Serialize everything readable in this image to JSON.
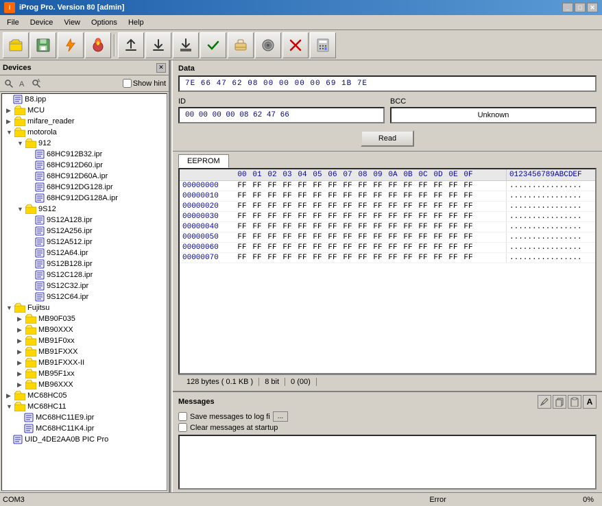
{
  "titleBar": {
    "title": "iProg Pro. Version 80 [admin]",
    "icon": "i"
  },
  "menuBar": {
    "items": [
      "File",
      "Device",
      "View",
      "Options",
      "Help"
    ]
  },
  "toolbar": {
    "buttons": [
      {
        "name": "open-button",
        "icon": "📂",
        "unicode": "📂"
      },
      {
        "name": "save-button",
        "icon": "💾",
        "unicode": "💾"
      },
      {
        "name": "flash-button",
        "icon": "⚡",
        "unicode": "⚡"
      },
      {
        "name": "burn-button",
        "icon": "🔴",
        "unicode": "🔴"
      },
      {
        "name": "upload-button",
        "icon": "▲",
        "unicode": "▲"
      },
      {
        "name": "download-button",
        "icon": "▼",
        "unicode": "▼"
      },
      {
        "name": "download2-button",
        "icon": "⬇",
        "unicode": "⬇"
      },
      {
        "name": "verify-button",
        "icon": "✔",
        "unicode": "✔"
      },
      {
        "name": "erase-button",
        "icon": "🧹",
        "unicode": "🧹"
      },
      {
        "name": "chip-button",
        "icon": "💿",
        "unicode": "💿"
      },
      {
        "name": "stop-button",
        "icon": "✖",
        "unicode": "✖"
      },
      {
        "name": "calc-button",
        "icon": "🖩",
        "unicode": "🖩"
      }
    ]
  },
  "devicesPanel": {
    "title": "Devices",
    "showHintLabel": "Show hint",
    "tree": [
      {
        "id": "b8ipp",
        "label": "B8.ipp",
        "level": 0,
        "type": "file",
        "expanded": false
      },
      {
        "id": "mcu",
        "label": "MCU",
        "level": 0,
        "type": "folder",
        "expanded": false
      },
      {
        "id": "mifare_reader",
        "label": "mifare_reader",
        "level": 0,
        "type": "folder",
        "expanded": false
      },
      {
        "id": "motorola",
        "label": "motorola",
        "level": 0,
        "type": "folder",
        "expanded": true
      },
      {
        "id": "912",
        "label": "912",
        "level": 1,
        "type": "folder",
        "expanded": true
      },
      {
        "id": "68hc912b32",
        "label": "68HC912B32.ipr",
        "level": 2,
        "type": "file"
      },
      {
        "id": "68hc912d60",
        "label": "68HC912D60.ipr",
        "level": 2,
        "type": "file"
      },
      {
        "id": "68hc912d60a",
        "label": "68HC912D60A.ipr",
        "level": 2,
        "type": "file"
      },
      {
        "id": "68hc912dg128",
        "label": "68HC912DG128.ipr",
        "level": 2,
        "type": "file"
      },
      {
        "id": "68hc912dg128a",
        "label": "68HC912DG128A.ipr",
        "level": 2,
        "type": "file"
      },
      {
        "id": "9s12",
        "label": "9S12",
        "level": 1,
        "type": "folder",
        "expanded": true
      },
      {
        "id": "9s12a128",
        "label": "9S12A128.ipr",
        "level": 2,
        "type": "file"
      },
      {
        "id": "9s12a256",
        "label": "9S12A256.ipr",
        "level": 2,
        "type": "file"
      },
      {
        "id": "9s12a512",
        "label": "9S12A512.ipr",
        "level": 2,
        "type": "file"
      },
      {
        "id": "9s12a64",
        "label": "9S12A64.ipr",
        "level": 2,
        "type": "file"
      },
      {
        "id": "9s12b128",
        "label": "9S12B128.ipr",
        "level": 2,
        "type": "file"
      },
      {
        "id": "9s12c128",
        "label": "9S12C128.ipr",
        "level": 2,
        "type": "file"
      },
      {
        "id": "9s12c32",
        "label": "9S12C32.ipr",
        "level": 2,
        "type": "file"
      },
      {
        "id": "9s12c64",
        "label": "9S12C64.ipr",
        "level": 2,
        "type": "file"
      },
      {
        "id": "fujitsu",
        "label": "Fujitsu",
        "level": 0,
        "type": "folder",
        "expanded": true
      },
      {
        "id": "mb90f035",
        "label": "MB90F035",
        "level": 1,
        "type": "folder"
      },
      {
        "id": "mb90xxx",
        "label": "MB90XXX",
        "level": 1,
        "type": "folder"
      },
      {
        "id": "mb91f0xx",
        "label": "MB91F0xx",
        "level": 1,
        "type": "folder"
      },
      {
        "id": "mb91fxxx",
        "label": "MB91FXXX",
        "level": 1,
        "type": "folder"
      },
      {
        "id": "mb91fxxx_i",
        "label": "MB91FXXX-II",
        "level": 1,
        "type": "folder"
      },
      {
        "id": "mb95f1xx",
        "label": "MB95F1xx",
        "level": 1,
        "type": "folder"
      },
      {
        "id": "mb96xxx",
        "label": "MB96XXX",
        "level": 1,
        "type": "folder"
      },
      {
        "id": "mc68hc05",
        "label": "MC68HC05",
        "level": 0,
        "type": "folder",
        "expanded": false
      },
      {
        "id": "mc68hc11",
        "label": "MC68HC11",
        "level": 0,
        "type": "folder",
        "expanded": true
      },
      {
        "id": "mc68hc11e9",
        "label": "MC68HC11E9.ipr",
        "level": 1,
        "type": "file"
      },
      {
        "id": "mc68hc11k4",
        "label": "MC68HC11K4.ipr",
        "level": 1,
        "type": "file"
      },
      {
        "id": "uid_4de2aa0b",
        "label": "UID_4DE2AA0B  PIC Pro",
        "level": 0,
        "type": "file"
      }
    ]
  },
  "dataSection": {
    "label": "Data",
    "hexValue": "7E  66  47  62  08  00  00  00  00  69  1B  7E",
    "idLabel": "ID",
    "idValue": "00  00  00  00  08  62  47  66",
    "bccLabel": "BCC",
    "bccValue": "Unknown",
    "readButton": "Read"
  },
  "eepromTab": {
    "tabLabel": "EEPROM",
    "headers": [
      "00",
      "01",
      "02",
      "03",
      "04",
      "05",
      "06",
      "07",
      "08",
      "09",
      "0A",
      "0B",
      "0C",
      "0D",
      "0E",
      "0F"
    ],
    "rows": [
      {
        "addr": "00000000",
        "bytes": [
          "FF",
          "FF",
          "FF",
          "FF",
          "FF",
          "FF",
          "FF",
          "FF",
          "FF",
          "FF",
          "FF",
          "FF",
          "FF",
          "FF",
          "FF",
          "FF"
        ],
        "ascii": "................"
      },
      {
        "addr": "00000010",
        "bytes": [
          "FF",
          "FF",
          "FF",
          "FF",
          "FF",
          "FF",
          "FF",
          "FF",
          "FF",
          "FF",
          "FF",
          "FF",
          "FF",
          "FF",
          "FF",
          "FF"
        ],
        "ascii": "................"
      },
      {
        "addr": "00000020",
        "bytes": [
          "FF",
          "FF",
          "FF",
          "FF",
          "FF",
          "FF",
          "FF",
          "FF",
          "FF",
          "FF",
          "FF",
          "FF",
          "FF",
          "FF",
          "FF",
          "FF"
        ],
        "ascii": "................"
      },
      {
        "addr": "00000030",
        "bytes": [
          "FF",
          "FF",
          "FF",
          "FF",
          "FF",
          "FF",
          "FF",
          "FF",
          "FF",
          "FF",
          "FF",
          "FF",
          "FF",
          "FF",
          "FF",
          "FF"
        ],
        "ascii": "................"
      },
      {
        "addr": "00000040",
        "bytes": [
          "FF",
          "FF",
          "FF",
          "FF",
          "FF",
          "FF",
          "FF",
          "FF",
          "FF",
          "FF",
          "FF",
          "FF",
          "FF",
          "FF",
          "FF",
          "FF"
        ],
        "ascii": "................"
      },
      {
        "addr": "00000050",
        "bytes": [
          "FF",
          "FF",
          "FF",
          "FF",
          "FF",
          "FF",
          "FF",
          "FF",
          "FF",
          "FF",
          "FF",
          "FF",
          "FF",
          "FF",
          "FF",
          "FF"
        ],
        "ascii": "................"
      },
      {
        "addr": "00000060",
        "bytes": [
          "FF",
          "FF",
          "FF",
          "FF",
          "FF",
          "FF",
          "FF",
          "FF",
          "FF",
          "FF",
          "FF",
          "FF",
          "FF",
          "FF",
          "FF",
          "FF"
        ],
        "ascii": "................"
      },
      {
        "addr": "00000070",
        "bytes": [
          "FF",
          "FF",
          "FF",
          "FF",
          "FF",
          "FF",
          "FF",
          "FF",
          "FF",
          "FF",
          "FF",
          "FF",
          "FF",
          "FF",
          "FF",
          "FF"
        ],
        "ascii": "................"
      }
    ]
  },
  "statusBar": {
    "size": "128 bytes ( 0.1 KB )",
    "bits": "8 bit",
    "value": "0 (00)"
  },
  "messagesSection": {
    "title": "Messages",
    "saveLogLabel": "Save messages to log fi",
    "browseLabel": "...",
    "clearStartupLabel": "Clear messages at startup",
    "toolButtons": [
      "🖊",
      "📋",
      "📄",
      "A"
    ]
  },
  "bottomStatus": {
    "leftText": "COM3",
    "errorText": "Error",
    "percentText": "0%"
  }
}
